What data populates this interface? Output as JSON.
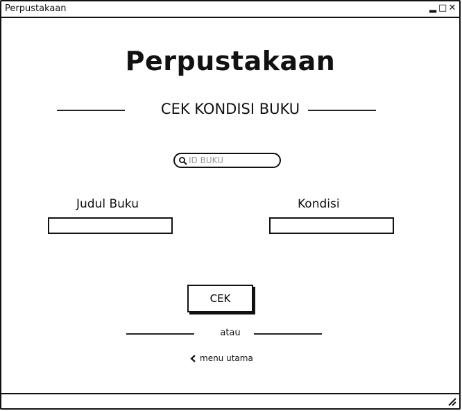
{
  "window": {
    "title": "Perpustakaan"
  },
  "app": {
    "title": "Perpustakaan",
    "section_title": "CEK KONDISI BUKU"
  },
  "search": {
    "placeholder": "ID BUKU"
  },
  "fields": {
    "judul_label": "Judul Buku",
    "kondisi_label": "Kondisi"
  },
  "actions": {
    "cek_label": "CEK",
    "or_label": "atau",
    "back_label": "menu utama"
  },
  "icons": {
    "window": [
      "minimize-icon",
      "maximize-icon",
      "close-icon"
    ],
    "search": "search-icon",
    "back": "chevron-left-icon",
    "resize": "resize-grip-icon"
  }
}
